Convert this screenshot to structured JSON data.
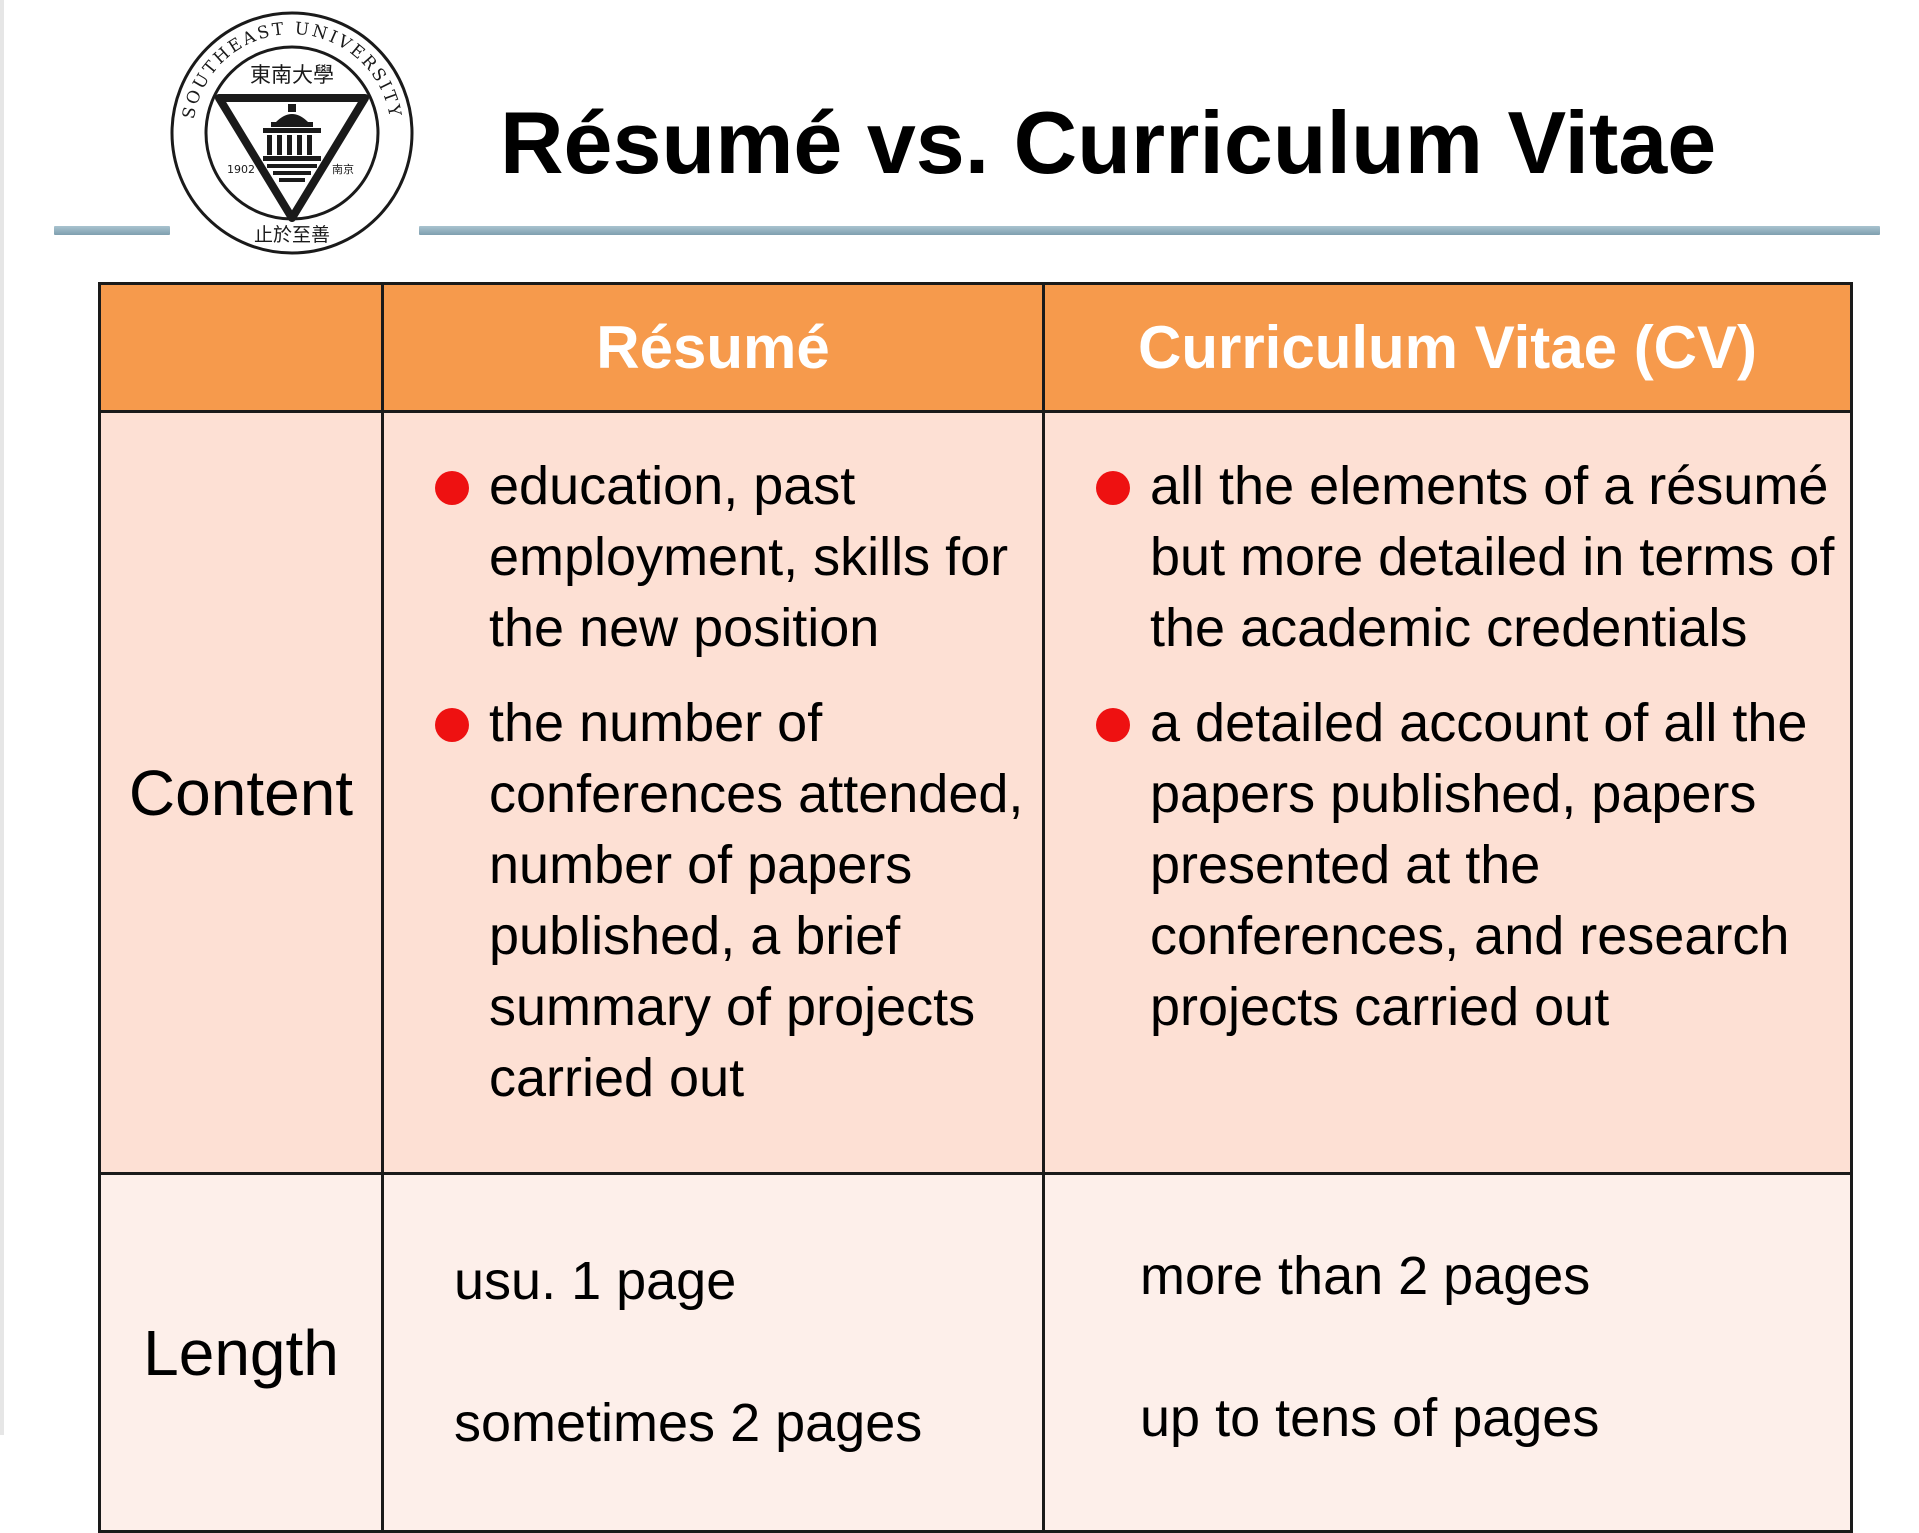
{
  "title": "Résumé vs. Curriculum Vitae",
  "logo": {
    "ring_text": "SOUTHEAST UNIVERSITY",
    "chinese_name": "東南大學",
    "year": "1902",
    "city": "南京",
    "motto": "止於至善",
    "accent_color": "#1a1a1a"
  },
  "table": {
    "header": {
      "corner": "",
      "col1": "Résumé",
      "col2": "Curriculum Vitae (CV)",
      "color": "#f69a4c"
    },
    "content_row": {
      "label": "Content",
      "resume_bullets": [
        "education, past employment, skills for the new position",
        "the number of conferences attended, number of papers published, a brief summary of projects carried out"
      ],
      "cv_bullets": [
        "all the elements of a résumé but more detailed in terms of the academic credentials",
        "a detailed account of all the papers published, papers presented at the conferences, and research projects carried out"
      ]
    },
    "length_row": {
      "label": "Length",
      "resume_lines": [
        "usu. 1 page",
        "sometimes 2 pages"
      ],
      "cv_lines": [
        "more than 2 pages",
        "up to tens of pages"
      ]
    },
    "bullet_color": "#ee1111"
  }
}
